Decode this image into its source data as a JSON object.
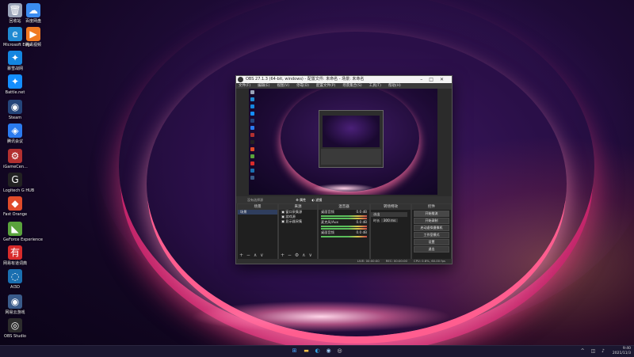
{
  "desktop": {
    "icons": [
      {
        "label": "回收站",
        "glyph": "🗑",
        "color": "#9aa4b8"
      },
      {
        "label": "百度网盘",
        "glyph": "☁",
        "color": "#3b8cf0"
      },
      {
        "label": "Microsoft Edge",
        "glyph": "e",
        "color": "#1f8ad2"
      },
      {
        "label": "腾讯视频",
        "glyph": "▶",
        "color": "#f07a22"
      },
      {
        "label": "暴雪战网",
        "glyph": "✦",
        "color": "#1486e0"
      },
      {
        "label": "Battle.net",
        "glyph": "✦",
        "color": "#148eff"
      },
      {
        "label": "Steam",
        "glyph": "◉",
        "color": "#24457a"
      },
      {
        "label": "腾讯会议",
        "glyph": "◈",
        "color": "#2b7bf0"
      },
      {
        "label": "iGameCen...",
        "glyph": "⚙",
        "color": "#b33030"
      },
      {
        "label": "Logitech G HUB",
        "glyph": "G",
        "color": "#222"
      },
      {
        "label": "Fast Orange",
        "glyph": "◆",
        "color": "#e04b2a"
      },
      {
        "label": "GeForce Experience",
        "glyph": "◣",
        "color": "#5aa33c"
      },
      {
        "label": "网易有道词典",
        "glyph": "有",
        "color": "#d82b2b"
      },
      {
        "label": "AI3D",
        "glyph": "◌",
        "color": "#1a6fb0"
      },
      {
        "label": "网易云游戏",
        "glyph": "◉",
        "color": "#3a5b8a"
      },
      {
        "label": "OBS Studio",
        "glyph": "◎",
        "color": "#2c2c2c"
      }
    ]
  },
  "obs": {
    "title": "OBS 27.1.3 (64-bit, windows) - 配置文件: 未命名 - 场景: 未命名",
    "menu": [
      "文件(F)",
      "编辑(E)",
      "视图(V)",
      "停靠(D)",
      "配置文件(P)",
      "场景集合(S)",
      "工具(T)",
      "帮助(H)"
    ],
    "strip_left": "没有选择源",
    "strip_props": "属性",
    "strip_filters": "滤镜",
    "docks": {
      "scenes": {
        "title": "场景",
        "items": [
          "场景"
        ]
      },
      "sources": {
        "title": "来源",
        "items": [
          "窗口采集源",
          "游戏源",
          "显示器采集"
        ]
      },
      "mixer": {
        "title": "混音器",
        "channels": [
          {
            "name": "桌面音频",
            "level": "0.0 dB"
          },
          {
            "name": "麦克风/Aux",
            "level": "0.0 dB"
          },
          {
            "name": "桌面音频",
            "level": "0.0 dB"
          }
        ]
      },
      "transitions": {
        "title": "转场特效",
        "type": "淡出",
        "duration_label": "时长",
        "duration": "300 ms"
      },
      "controls": {
        "title": "控件",
        "buttons": [
          "开始推流",
          "开始录制",
          "启动虚拟摄像机",
          "工作室模式",
          "设置",
          "退出"
        ]
      }
    },
    "statusbar": [
      "LIVE: 00:00:00",
      "REC: 00:00:00",
      "CPU: 0.8%, 60.00 fps"
    ]
  },
  "taskbar": {
    "pinned": [
      "start",
      "search",
      "task-view",
      "file-explorer",
      "edge",
      "steam",
      "obs"
    ],
    "time": "9:40",
    "date": "2021/11/3"
  },
  "colors": {
    "accent": "#c3256a",
    "obs_bg": "#2b2b2b",
    "taskbar": "#1b1730"
  }
}
